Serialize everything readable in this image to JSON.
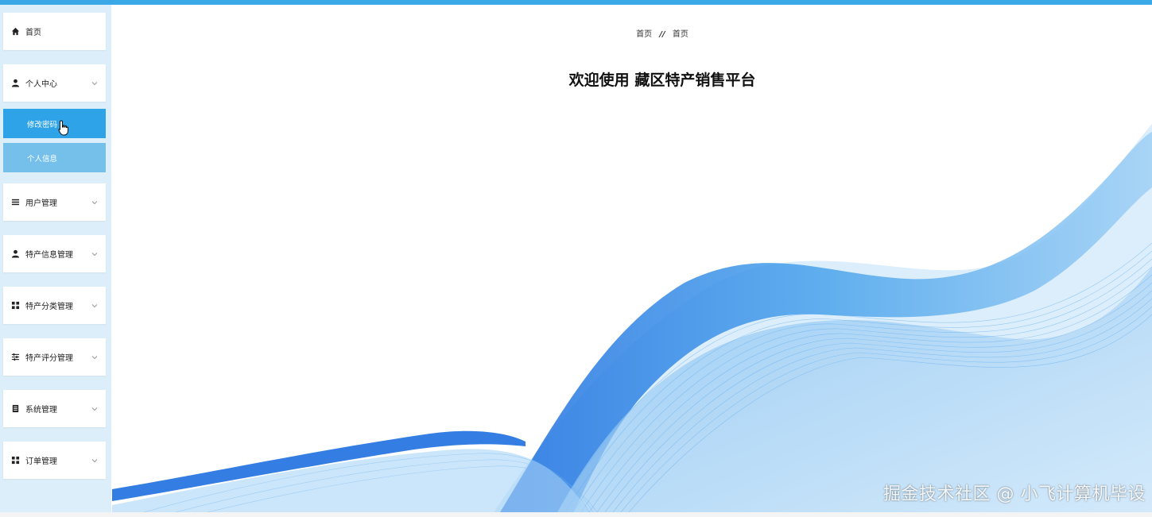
{
  "breadcrumb": {
    "first": "首页",
    "separator": "//",
    "second": "首页"
  },
  "welcome": {
    "prefix": "欢迎使用",
    "app_name": "藏区特产销售平台"
  },
  "sidebar": {
    "items": [
      {
        "label": "首页",
        "icon": "home-icon"
      },
      {
        "label": "个人中心",
        "icon": "user-icon"
      },
      {
        "label": "用户管理",
        "icon": "list-icon"
      },
      {
        "label": "特产信息管理",
        "icon": "user-icon"
      },
      {
        "label": "特产分类管理",
        "icon": "grid-icon"
      },
      {
        "label": "特产评分管理",
        "icon": "sliders-icon"
      },
      {
        "label": "系统管理",
        "icon": "doc-icon"
      },
      {
        "label": "订单管理",
        "icon": "grid-icon"
      }
    ],
    "submenu": [
      {
        "label": "修改密码",
        "active": true
      },
      {
        "label": "个人信息",
        "active": false
      }
    ]
  },
  "watermark": "掘金技术社区 @ 小飞计算机毕设",
  "colors": {
    "topbar": "#3aa8e6",
    "sidebar_bg": "#dceef9",
    "submenu_active": "#2ea3e8",
    "submenu_normal": "#74c0ea",
    "wave_blue": "#2f8fe6"
  }
}
